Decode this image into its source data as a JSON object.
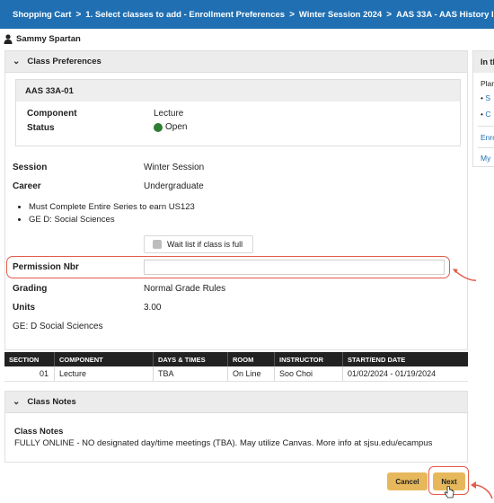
{
  "breadcrumb": [
    "Shopping Cart",
    "1.  Select classes to add - Enrollment Preferences",
    "Winter Session 2024",
    "AAS   33A - AAS History I"
  ],
  "breadcrumb_separator": ">",
  "user": {
    "name": "Sammy Spartan"
  },
  "class_preferences": {
    "title": "Class Preferences",
    "class_code": "AAS   33A-01",
    "component_label": "Component",
    "component_value": "Lecture",
    "status_label": "Status",
    "status_value": "Open",
    "status_color": "#2e7d32",
    "session_label": "Session",
    "session_value": "Winter Session",
    "career_label": "Career",
    "career_value": "Undergraduate",
    "requirements": [
      "Must Complete Entire Series to earn US123",
      "GE D: Social Sciences"
    ],
    "waitlist_label": "Wait list if class is full",
    "permission_label": "Permission Nbr",
    "permission_value": "",
    "grading_label": "Grading",
    "grading_value": "Normal Grade Rules",
    "units_label": "Units",
    "units_value": "3.00",
    "ge_note": "GE: D Social Sciences"
  },
  "sections_table": {
    "headers": [
      "SECTION",
      "COMPONENT",
      "DAYS & TIMES",
      "ROOM",
      "INSTRUCTOR",
      "START/END DATE"
    ],
    "rows": [
      [
        "01",
        "Lecture",
        "TBA",
        "On Line",
        "Soo Choi",
        "01/02/2024 - 01/19/2024"
      ]
    ]
  },
  "class_notes": {
    "panel_title": "Class Notes",
    "heading": "Class Notes",
    "text": "FULLY ONLINE - NO designated day/time meetings (TBA). May utilize Canvas. More info at sjsu.edu/ecampus"
  },
  "buttons": {
    "cancel": "Cancel",
    "next": "Next"
  },
  "right_panel": {
    "title": "In th",
    "plan": "Plan",
    "link1": "S",
    "link2": "C",
    "enroll": "Enro",
    "my": "My"
  },
  "colors": {
    "header_blue": "#1f6fb2",
    "button_gold": "#e7b85b",
    "annotation_red": "#e25b4a"
  }
}
